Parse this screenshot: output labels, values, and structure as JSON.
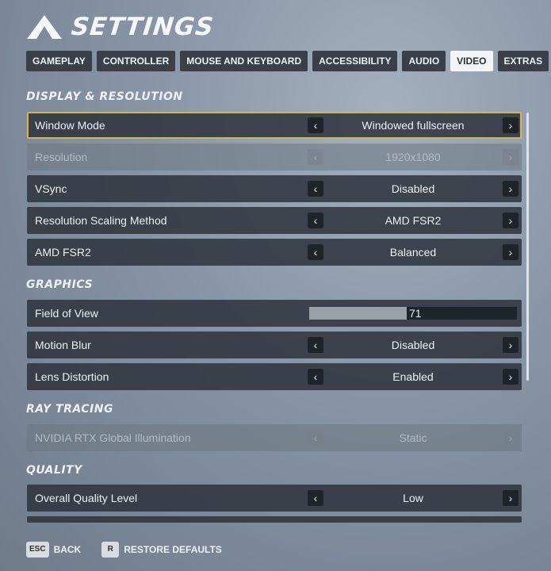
{
  "header": {
    "title": "SETTINGS"
  },
  "tabs": [
    {
      "label": "GAMEPLAY",
      "active": false
    },
    {
      "label": "CONTROLLER",
      "active": false
    },
    {
      "label": "MOUSE AND KEYBOARD",
      "active": false
    },
    {
      "label": "ACCESSIBILITY",
      "active": false
    },
    {
      "label": "AUDIO",
      "active": false
    },
    {
      "label": "VIDEO",
      "active": true
    },
    {
      "label": "EXTRAS",
      "active": false
    }
  ],
  "sections": {
    "display": "DISPLAY & RESOLUTION",
    "graphics": "GRAPHICS",
    "ray_tracing": "RAY TRACING",
    "quality": "QUALITY"
  },
  "rows": {
    "window_mode": {
      "label": "Window Mode",
      "value": "Windowed fullscreen"
    },
    "resolution": {
      "label": "Resolution",
      "value": "1920x1080"
    },
    "vsync": {
      "label": "VSync",
      "value": "Disabled"
    },
    "scaling": {
      "label": "Resolution Scaling Method",
      "value": "AMD FSR2"
    },
    "fsr2": {
      "label": "AMD FSR2",
      "value": "Balanced"
    },
    "fov": {
      "label": "Field of View",
      "value": "71",
      "fill_fraction": 0.47
    },
    "motion_blur": {
      "label": "Motion Blur",
      "value": "Disabled"
    },
    "lens": {
      "label": "Lens Distortion",
      "value": "Enabled"
    },
    "rtx_gi": {
      "label": "NVIDIA RTX Global Illumination",
      "value": "Static"
    },
    "quality_level": {
      "label": "Overall Quality Level",
      "value": "Low"
    }
  },
  "arrows": {
    "left": "‹",
    "right": "›"
  },
  "footer": {
    "back_key": "ESC",
    "back_label": "BACK",
    "restore_key": "R",
    "restore_label": "RESTORE DEFAULTS"
  },
  "colors": {
    "selected_border": "#d9b250",
    "active_tab_bg": "#f2f4f6"
  }
}
